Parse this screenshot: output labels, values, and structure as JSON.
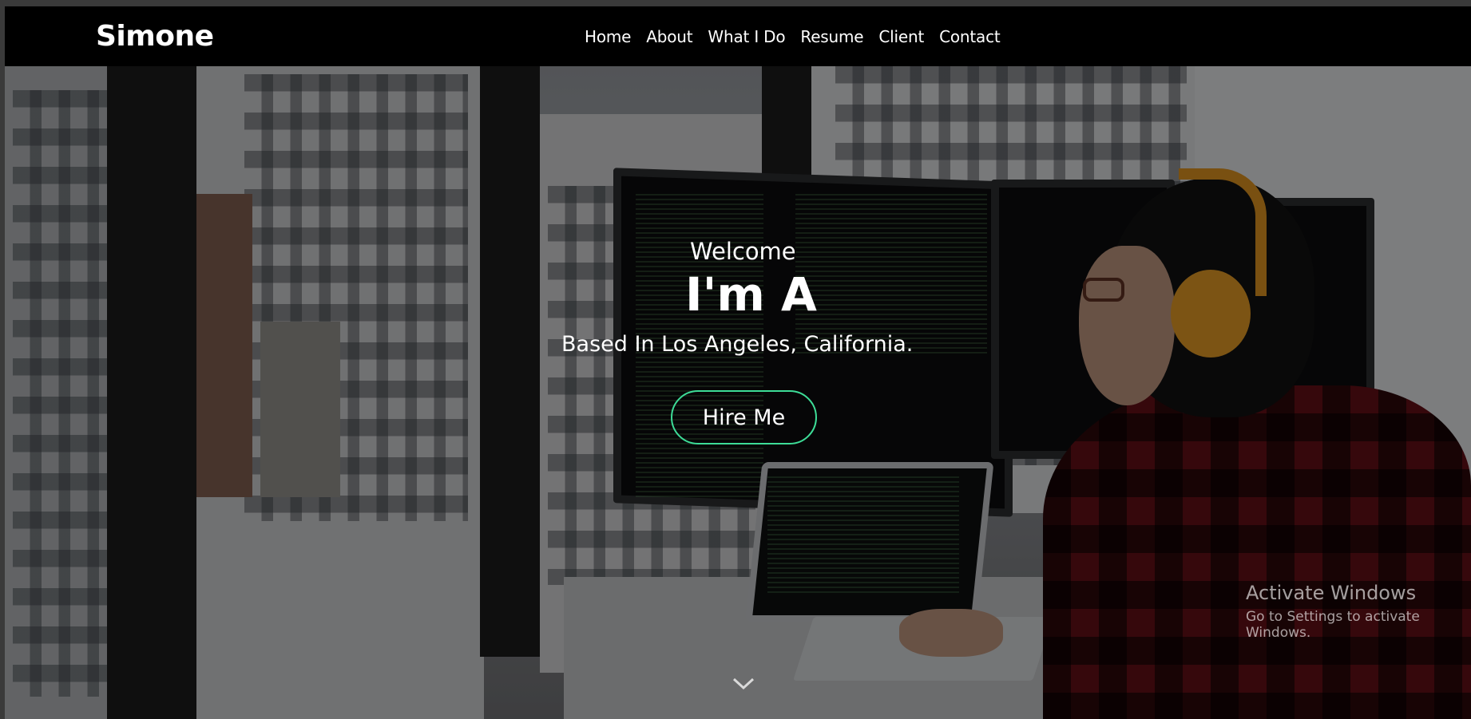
{
  "brand": {
    "logo": "Simone"
  },
  "nav": {
    "items": [
      {
        "label": "Home"
      },
      {
        "label": "About"
      },
      {
        "label": "What I Do"
      },
      {
        "label": "Resume"
      },
      {
        "label": "Client"
      },
      {
        "label": "Contact"
      }
    ]
  },
  "hero": {
    "welcome": "Welcome",
    "headline": "I'm A",
    "location": "Based In Los Angeles, California.",
    "cta_label": "Hire Me",
    "scroll_icon": "chevron-down-icon",
    "accent_color": "#3ddc97"
  },
  "watermark": {
    "title": "Activate Windows",
    "subtitle": "Go to Settings to activate Windows."
  }
}
